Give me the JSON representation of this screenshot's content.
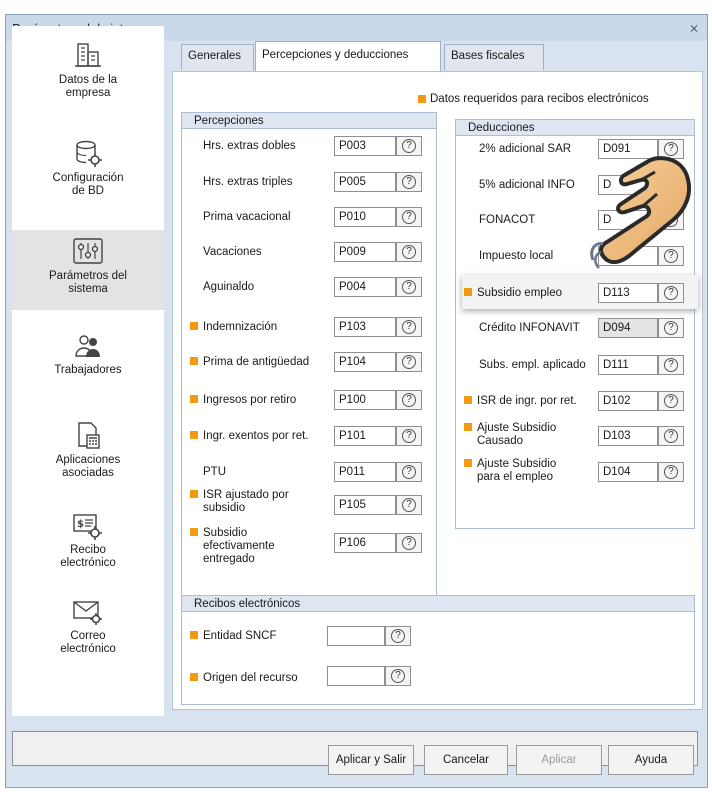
{
  "window": {
    "title": "Parámetros del sistema",
    "close_glyph": "⨯"
  },
  "sidebar": {
    "items": [
      {
        "label_l1": "Datos de la",
        "label_l2": "empresa",
        "icon": "building-icon"
      },
      {
        "label_l1": "Configuración",
        "label_l2": "de BD",
        "icon": "database-gear-icon"
      },
      {
        "label_l1": "Parámetros del",
        "label_l2": "sistema",
        "icon": "sliders-icon",
        "active": true
      },
      {
        "label_l1": "Trabajadores",
        "label_l2": "",
        "icon": "users-icon"
      },
      {
        "label_l1": "Aplicaciones",
        "label_l2": "asociadas",
        "icon": "calculator-doc-icon"
      },
      {
        "label_l1": "Recibo",
        "label_l2": "electrónico",
        "icon": "receipt-gear-icon"
      },
      {
        "label_l1": "Correo",
        "label_l2": "electrónico",
        "icon": "mail-gear-icon"
      }
    ]
  },
  "tabs": [
    {
      "label": "Generales"
    },
    {
      "label": "Percepciones y deducciones",
      "active": true
    },
    {
      "label": "Bases fiscales"
    }
  ],
  "legend": "Datos requeridos para recibos electrónicos",
  "percepciones": {
    "title": "Percepciones",
    "rows": [
      {
        "label": "Hrs. extras dobles",
        "code": "P003",
        "required": false
      },
      {
        "label": "Hrs. extras triples",
        "code": "P005",
        "required": false
      },
      {
        "label": "Prima vacacional",
        "code": "P010",
        "required": false
      },
      {
        "label": "Vacaciones",
        "code": "P009",
        "required": false
      },
      {
        "label": "Aguinaldo",
        "code": "P004",
        "required": false
      },
      {
        "label": "Indemnización",
        "code": "P103",
        "required": true
      },
      {
        "label": "Prima de antigüedad",
        "code": "P104",
        "required": true
      },
      {
        "label": "Ingresos por retiro",
        "code": "P100",
        "required": true
      },
      {
        "label": "Ingr. exentos por ret.",
        "code": "P101",
        "required": true
      },
      {
        "label": "PTU",
        "code": "P011",
        "required": false
      },
      {
        "label_l1": "ISR ajustado por",
        "label_l2": "subsidio",
        "code": "P105",
        "required": true
      },
      {
        "label_l1": "Subsidio",
        "label_l2": "efectivamente",
        "label_l3": "entregado",
        "code": "P106",
        "required": true
      }
    ]
  },
  "deducciones": {
    "title": "Deducciones",
    "rows": [
      {
        "label": "2% adicional SAR",
        "code": "D091",
        "required": false
      },
      {
        "label": "5% adicional INFO",
        "code": "D",
        "required": false
      },
      {
        "label": "FONACOT",
        "code": "D",
        "required": false
      },
      {
        "label": "Impuesto local",
        "code": "D",
        "required": false
      },
      {
        "label": "Subsidio empleo",
        "code": "D113",
        "required": true
      },
      {
        "label": "Crédito INFONAVIT",
        "code": "D094",
        "required": false,
        "disabled": true
      },
      {
        "label": "Subs. empl. aplicado",
        "code": "D111",
        "required": false
      },
      {
        "label": "ISR de ingr. por ret.",
        "code": "D102",
        "required": true
      },
      {
        "label_l1": "Ajuste Subsidio",
        "label_l2": "Causado",
        "code": "D103",
        "required": true
      },
      {
        "label_l1": "Ajuste Subsidio",
        "label_l2": "para el empleo",
        "code": "D104",
        "required": true
      }
    ]
  },
  "recibos": {
    "title": "Recibos electrónicos",
    "rows": [
      {
        "label": "Entidad SNCF",
        "value": "",
        "required": true
      },
      {
        "label": "Origen del recurso",
        "value": "",
        "required": true
      }
    ]
  },
  "buttons": {
    "apply_exit": "Aplicar y Salir",
    "cancel": "Cancelar",
    "apply": "Aplicar",
    "help": "Ayuda"
  },
  "help_glyph": "?",
  "colors": {
    "required": "#f49a12",
    "title_bar": "#c9d8ea",
    "group_header": "#dde6f1"
  }
}
